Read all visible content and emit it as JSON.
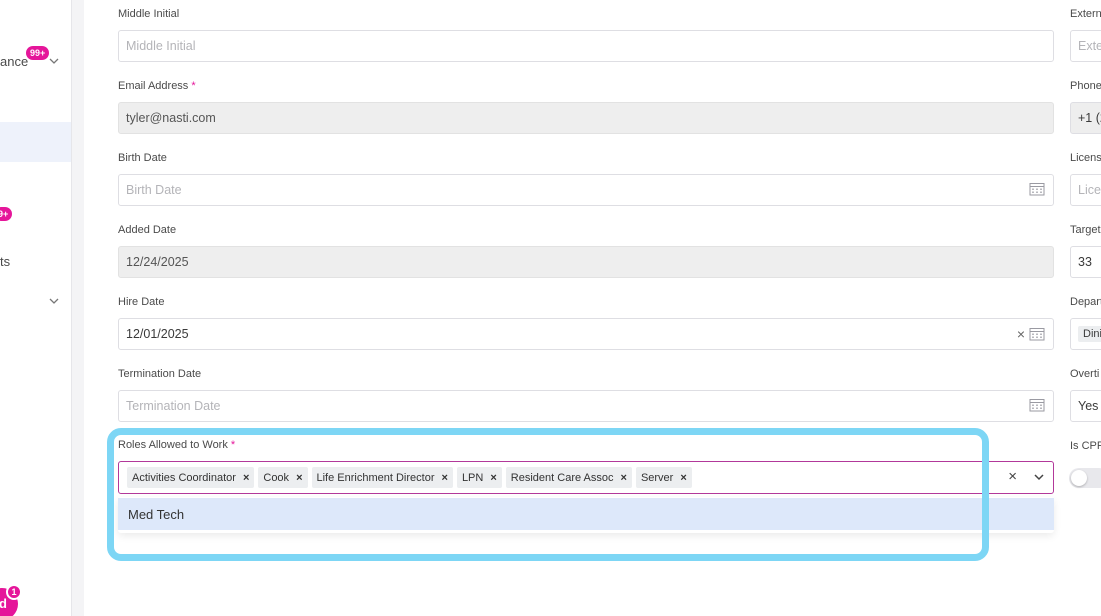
{
  "sidebar": {
    "items": [
      {
        "label": "ance",
        "badge": "99+"
      },
      {
        "label": "",
        "badge": "9+"
      },
      {
        "label": "ts",
        "badge": ""
      }
    ],
    "avatar_initial": "d",
    "avatar_badge": "1"
  },
  "form": {
    "middle_initial": {
      "label": "Middle Initial",
      "placeholder": "Middle Initial"
    },
    "email": {
      "label": "Email Address",
      "value": "tyler@nasti.com",
      "required": "*"
    },
    "birth_date": {
      "label": "Birth Date",
      "placeholder": "Birth Date"
    },
    "added_date": {
      "label": "Added Date",
      "value": "12/24/2025"
    },
    "hire_date": {
      "label": "Hire Date",
      "value": "12/01/2025"
    },
    "termination_date": {
      "label": "Termination Date",
      "placeholder": "Termination Date"
    },
    "roles": {
      "label": "Roles Allowed to Work",
      "required": "*",
      "selected": [
        "Activities Coordinator",
        "Cook",
        "Life Enrichment Director",
        "LPN",
        "Resident Care Assoc",
        "Server"
      ],
      "chip_remove": "×",
      "clear": "×",
      "options": [
        "Med Tech"
      ]
    }
  },
  "right_column": {
    "labels": [
      "Extern",
      "Phone",
      "Licens",
      "Target",
      "Depart",
      "Overti",
      "Is CPR"
    ],
    "values": {
      "external": "Exte",
      "phone": "+1 (2",
      "license": "Lice",
      "target": "33",
      "department": "Dini",
      "overtime": "Yes"
    }
  },
  "colors": {
    "accent": "#e5169a",
    "focus_border": "#b2389a",
    "highlight": "#7dd6f5",
    "option_hover": "#dde8fa"
  }
}
